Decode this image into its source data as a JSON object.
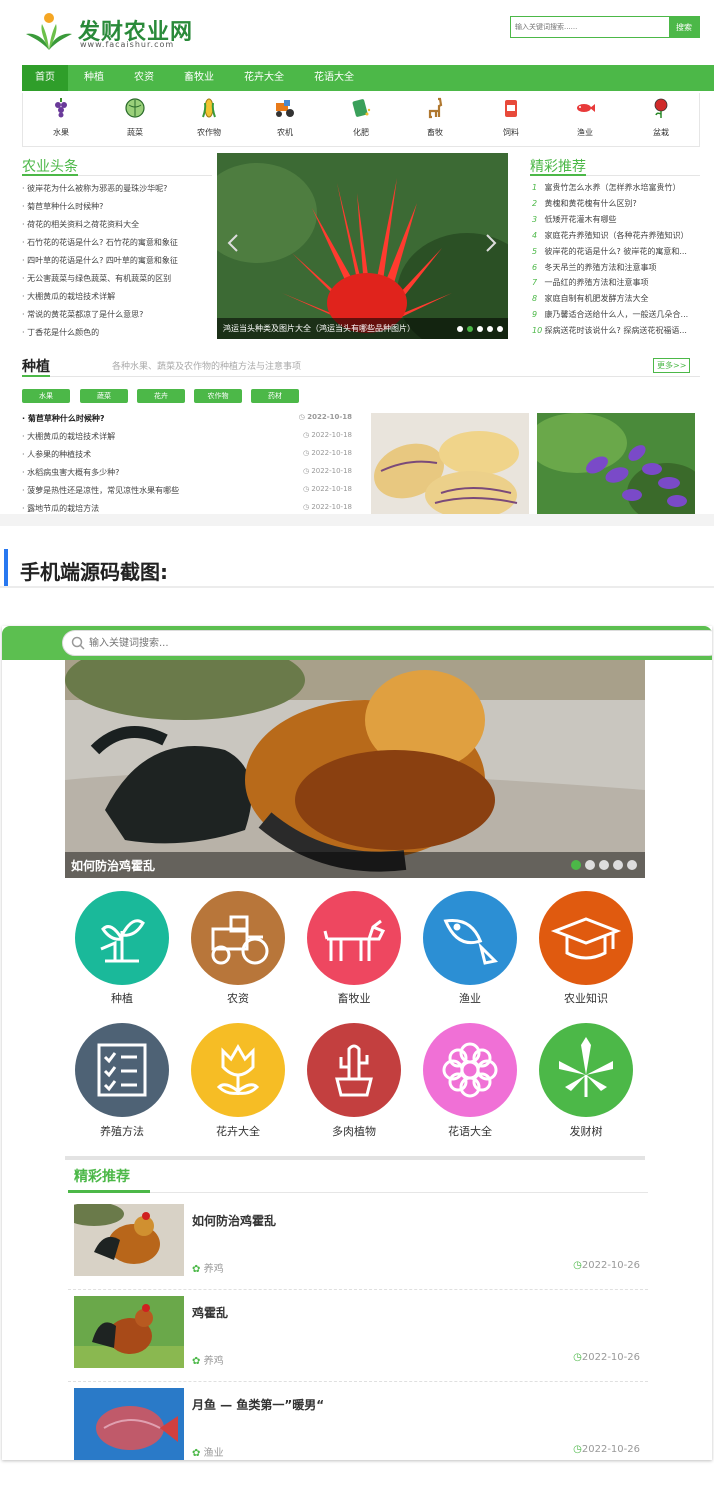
{
  "desktop": {
    "logo_text": "发财农业网",
    "logo_url": "www.facaishur.com",
    "search_placeholder": "输入关键词搜索......",
    "search_btn": "搜索",
    "nav": [
      "首页",
      "种植",
      "农资",
      "畜牧业",
      "花卉大全",
      "花语大全"
    ],
    "categories": [
      "水果",
      "蔬菜",
      "农作物",
      "农机",
      "化肥",
      "畜牧",
      "饲料",
      "渔业",
      "盆栽"
    ],
    "headlines_title": "农业头条",
    "headlines": [
      "彼岸花为什么被称为邪恶的曼珠沙华呢?",
      "菊苣草种什么时候种?",
      "荷花的相关资料之荷花资料大全",
      "石竹花的花语是什么? 石竹花的寓意和象征",
      "四叶草的花语是什么? 四叶草的寓意和象征",
      "无公害蔬菜与绿色蔬菜、有机蔬菜的区别",
      "大棚黄瓜的栽培技术详解",
      "常说的黄花菜都凉了是什么意思?",
      "丁香花是什么颜色的"
    ],
    "slider_caption": "鸿运当头种类及图片大全（鸿运当头有哪些品种图片）",
    "featured_title": "精彩推荐",
    "featured": [
      {
        "n": "1",
        "t": "富贵竹怎么水养（怎样养水培富贵竹）"
      },
      {
        "n": "2",
        "t": "黄槐和黄花槐有什么区别?"
      },
      {
        "n": "3",
        "t": "低矮开花灌木有哪些"
      },
      {
        "n": "4",
        "t": "家庭花卉养殖知识（各种花卉养殖知识）"
      },
      {
        "n": "5",
        "t": "彼岸花的花语是什么? 彼岸花的寓意和..."
      },
      {
        "n": "6",
        "t": "冬天吊兰的养殖方法和注意事项"
      },
      {
        "n": "7",
        "t": "一品红的养殖方法和注意事项"
      },
      {
        "n": "8",
        "t": "家庭自制有机肥发酵方法大全"
      },
      {
        "n": "9",
        "t": "康乃馨适合送给什么人，一般送几朵合..."
      },
      {
        "n": "10",
        "t": "探病送花时该说什么? 探病送花祝福语..."
      }
    ],
    "plant_title": "种植",
    "plant_subtitle": "各种水果、蔬菜及农作物的种植方法与注意事项",
    "more": "更多>>",
    "plant_tags": [
      "水果",
      "蔬菜",
      "花卉",
      "农作物",
      "药材"
    ],
    "plant_items": [
      {
        "t": "菊苣草种什么时候种?",
        "d": "2022-10-18"
      },
      {
        "t": "大棚黄瓜的栽培技术详解",
        "d": "2022-10-18"
      },
      {
        "t": "人参果的种植技术",
        "d": "2022-10-18"
      },
      {
        "t": "水稻病虫害大概有多少种?",
        "d": "2022-10-18"
      },
      {
        "t": "菠萝是热性还是凉性，常见凉性水果有哪些",
        "d": "2022-10-18"
      },
      {
        "t": "露地节瓜的栽培方法",
        "d": "2022-10-18"
      }
    ]
  },
  "heading": "手机端源码截图:",
  "mobile": {
    "search_placeholder": "输入关键词搜索...",
    "banner_caption": "如何防治鸡霍乱",
    "grid": [
      {
        "label": "种植",
        "color": "#1ab99a",
        "icon": "plant-icon"
      },
      {
        "label": "农资",
        "color": "#b8763a",
        "icon": "tractor-icon"
      },
      {
        "label": "畜牧业",
        "color": "#ee4760",
        "icon": "goat-icon"
      },
      {
        "label": "渔业",
        "color": "#2c8fd4",
        "icon": "fish-icon"
      },
      {
        "label": "农业知识",
        "color": "#e05a0f",
        "icon": "graduation-cap-icon"
      },
      {
        "label": "养殖方法",
        "color": "#4e6275",
        "icon": "checklist-icon"
      },
      {
        "label": "花卉大全",
        "color": "#f6bd25",
        "icon": "tulip-icon"
      },
      {
        "label": "多肉植物",
        "color": "#c33f3f",
        "icon": "cactus-icon"
      },
      {
        "label": "花语大全",
        "color": "#f070d6",
        "icon": "flower-icon"
      },
      {
        "label": "发财树",
        "color": "#4cb848",
        "icon": "leaf-icon"
      }
    ],
    "rec_title": "精彩推荐",
    "rec_items": [
      {
        "title": "如何防治鸡霍乱",
        "tag": "养鸡",
        "date": "2022-10-26"
      },
      {
        "title": "鸡霍乱",
        "tag": "养鸡",
        "date": "2022-10-26"
      },
      {
        "title": "月鱼 — 鱼类第一”暖男“",
        "tag": "渔业",
        "date": "2022-10-26"
      }
    ]
  }
}
